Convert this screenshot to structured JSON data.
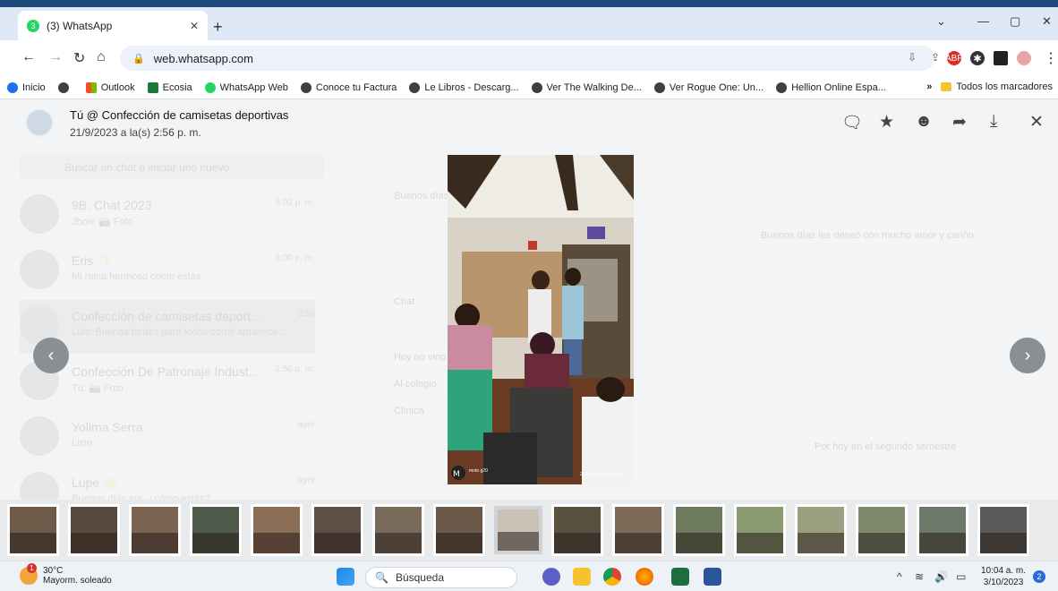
{
  "browser": {
    "tab_title": "(3) WhatsApp",
    "tab_badge": "3",
    "url": "web.whatsapp.com",
    "bookmarks": [
      {
        "label": "Inicio"
      },
      {
        "label": ""
      },
      {
        "label": "Outlook"
      },
      {
        "label": "Ecosia"
      },
      {
        "label": "WhatsApp Web"
      },
      {
        "label": "Conoce tu Factura"
      },
      {
        "label": "Le Libros - Descarg..."
      },
      {
        "label": "Ver The Walking De..."
      },
      {
        "label": "Ver Rogue One: Un..."
      },
      {
        "label": "Hellion Online Espa..."
      }
    ],
    "more_bookmarks": "»",
    "all_bookmarks": "Todos los marcadores"
  },
  "viewer": {
    "sender_title": "Tú @ Confección de camisetas deportivas",
    "date": "21/9/2023 a la(s) 2:56 p. m.",
    "photo_watermark": "moto g20",
    "photo_timestamp": "2023 09 21 14:46:46",
    "thumbnail_count": 17,
    "selected_thumbnail": 9
  },
  "background_chat": {
    "search_placeholder": "Buscar un chat o iniciar uno nuevo",
    "chats": [
      {
        "name": "9B. Chat 2023",
        "sub": "Jhon: 📷 Foto",
        "time": "6:02 p. m."
      },
      {
        "name": "Eris ✨",
        "sub": "Mi reina hermosa como estás",
        "time": "6:00 p. m."
      },
      {
        "name": "Confección de camisetas deport...",
        "sub": "Luis: Buenas tardes para todos como amanece...",
        "time": "2:56"
      },
      {
        "name": "Confección De Patronaje Indust...",
        "sub": "Tú: 📷 Foto",
        "time": "2:56 p. m."
      },
      {
        "name": "Yolima Serra",
        "sub": "Listo",
        "time": "ayer"
      },
      {
        "name": "Lupe 🌟",
        "sub": "Buenos días sra. ¿cómo estás?",
        "time": "ayer"
      }
    ],
    "messages": [
      {
        "text": "Buenos días"
      },
      {
        "text": "Buenos días les deseo con mucho amor y cariño"
      },
      {
        "text": "Chat"
      },
      {
        "text": "Hoy no vino"
      },
      {
        "text": "Al colegio"
      },
      {
        "text": "Clínica"
      },
      {
        "text": "Por hoy en el segundo semestre"
      }
    ]
  },
  "taskbar": {
    "temperature": "30°C",
    "weather": "Mayorm. soleado",
    "weather_badge": "1",
    "search_label": "Búsqueda",
    "time": "10:04 a. m.",
    "date": "3/10/2023",
    "notification_count": "2"
  },
  "colors": {
    "accent_blue": "#1a73e8",
    "whatsapp_green": "#25d366",
    "viewer_bg": "#f3f4f5",
    "taskbar_bg": "#eef1f6"
  }
}
